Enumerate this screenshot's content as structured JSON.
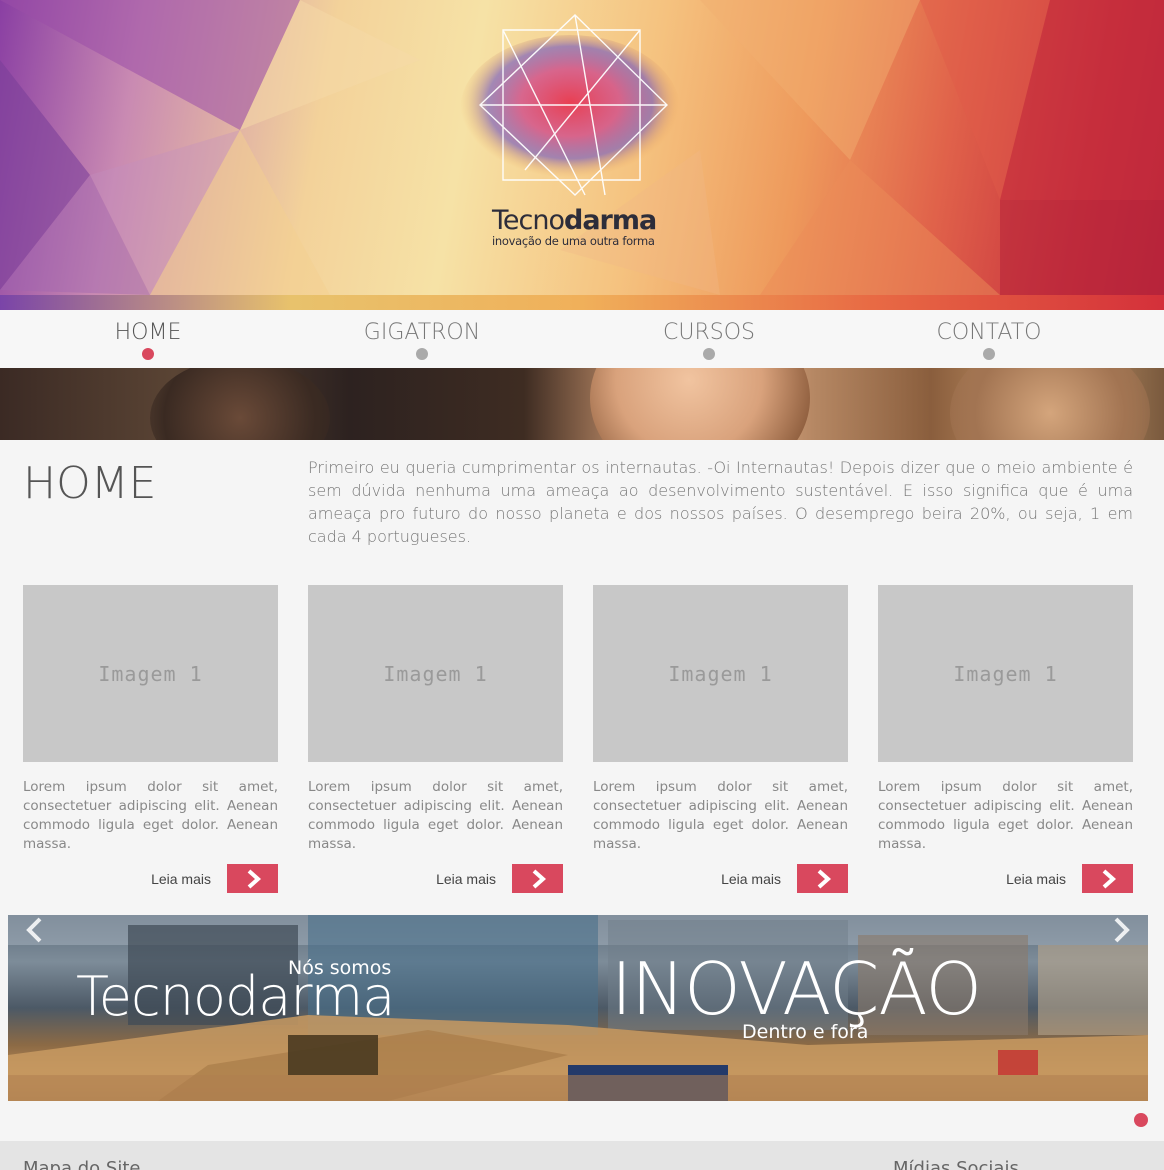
{
  "brand": {
    "name_light": "Tecno",
    "name_bold": "darma",
    "tagline": "inovação de uma outra forma"
  },
  "nav": {
    "items": [
      {
        "label": "HOME",
        "active": true
      },
      {
        "label": "GIGATRON",
        "active": false
      },
      {
        "label": "CURSOS",
        "active": false
      },
      {
        "label": "CONTATO",
        "active": false
      }
    ]
  },
  "main": {
    "title": "HOME",
    "intro": "Primeiro eu queria cumprimentar os internautas. -Oi Internautas! Depois dizer que o meio ambiente é sem dúvida nenhuma uma ameaça ao desenvolvimento sustentável. E isso significa que é uma ameaça pro futuro do nosso planeta e dos nossos países. O desemprego beira 20%, ou seja, 1 em cada 4 portugueses."
  },
  "cards": [
    {
      "image_label": "Imagem 1",
      "text": "Lorem ipsum dolor sit amet, consectetuer adipiscing elit. Aenean commodo ligula eget dolor. Aenean massa.",
      "more": "Leia mais"
    },
    {
      "image_label": "Imagem 1",
      "text": "Lorem ipsum dolor sit amet, consectetuer adipiscing elit. Aenean commodo ligula eget dolor. Aenean massa.",
      "more": "Leia mais"
    },
    {
      "image_label": "Imagem 1",
      "text": "Lorem ipsum dolor sit amet, consectetuer adipiscing elit. Aenean commodo ligula eget dolor. Aenean massa.",
      "more": "Leia mais"
    },
    {
      "image_label": "Imagem 1",
      "text": "Lorem ipsum dolor sit amet, consectetuer adipiscing elit. Aenean commodo ligula eget dolor. Aenean massa.",
      "more": "Leia mais"
    }
  ],
  "slider": {
    "small": "Nós somos",
    "brand": "Tecnodarma",
    "big": "INOVAÇÃO",
    "sub": "Dentro e fora"
  },
  "footer": {
    "left": "Mapa do Site",
    "right": "Mídias Sociais"
  },
  "colors": {
    "accent": "#d9485e",
    "dot_inactive": "#aaaaaa"
  },
  "icons": {
    "slider_prev": "chevron-left-icon",
    "slider_next": "chevron-right-icon",
    "card_more": "chevron-right-icon"
  }
}
